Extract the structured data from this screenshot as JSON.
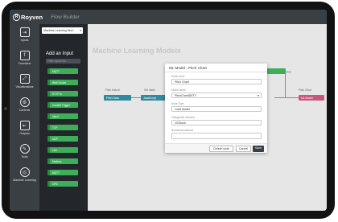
{
  "app": {
    "brand": "Royven",
    "brand_mark": "R",
    "title": "Flow Builder"
  },
  "sidebar": {
    "items": [
      {
        "label": "Inputs",
        "icon": "inputs-icon",
        "glyph": "⇥"
      },
      {
        "label": "Functions",
        "icon": "function-icon",
        "glyph": "f"
      },
      {
        "label": "Visualizations",
        "icon": "visualization-icon",
        "glyph": "⤢"
      },
      {
        "label": "Controls",
        "icon": "controls-icon",
        "glyph": "⚙"
      },
      {
        "label": "Outputs",
        "icon": "outputs-icon",
        "glyph": "⇤"
      },
      {
        "label": "Tools",
        "icon": "tools-icon",
        "glyph": "✎"
      },
      {
        "label": "Machine Learning",
        "icon": "machine-learning-icon",
        "glyph": "◎"
      }
    ]
  },
  "palette": {
    "model_selector": "Machine Learning Mod...",
    "title": "Add an Input",
    "search_placeholder": "Filter inputs list...",
    "items": [
      {
        "label": "MQTT"
      },
      {
        "label": "Web Socket"
      },
      {
        "label": "HTTP In"
      },
      {
        "label": "Content Trigger"
      },
      {
        "label": "Inject"
      },
      {
        "label": "TCP"
      },
      {
        "label": "UDP"
      },
      {
        "label": "Link"
      },
      {
        "label": "Modbus"
      },
      {
        "label": "MQTT"
      },
      {
        "label": "OPC"
      }
    ]
  },
  "canvas": {
    "title": "Machine Learning Models",
    "nodes": [
      {
        "label": "Pitch Data",
        "caption": "Pitch Data In"
      },
      {
        "label": "JavaScript",
        "caption": "Get Value"
      },
      {
        "label": "Flow",
        "caption": "Flow"
      },
      {
        "label": "ML Model",
        "caption": "Pitch Chart"
      },
      {
        "label": "Lookup",
        "caption": "Lookup"
      },
      {
        "label": "JSON",
        "caption": "JSON"
      }
    ]
  },
  "dialog": {
    "title": "ML Model - Pitch Chart",
    "fields": [
      {
        "label": "Node name",
        "value": "Pitch Chart"
      },
      {
        "label": "Model name",
        "value": "PitchChartIDETY"
      },
      {
        "label": "Node Type",
        "value": "Load Model"
      },
      {
        "label": "Categorical columns",
        "value": "OODuck"
      },
      {
        "label": "Numerical columns",
        "value": ""
      }
    ],
    "buttons": {
      "delete": "Delete node",
      "cancel": "Cancel",
      "save": "Save"
    }
  },
  "colors": {
    "input_node": "#3fae5a",
    "function_node": "#2f8a9e",
    "output_node": "#c9557c",
    "topbar": "#3a3f44",
    "palette_bg": "#23272b"
  }
}
